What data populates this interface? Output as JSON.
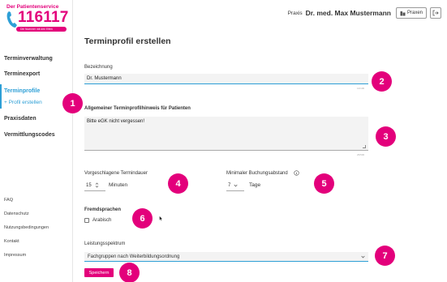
{
  "logo": {
    "top_text": "Der Patientenservice",
    "number": "116117",
    "subtitle": "Die Nummer mit den Elfen"
  },
  "sidebar": {
    "items": [
      {
        "label": "Terminverwaltung"
      },
      {
        "label": "Terminexport"
      },
      {
        "label": "Terminprofile"
      },
      {
        "label": "+ Profil erstellen"
      },
      {
        "label": "Praxisdaten"
      },
      {
        "label": "Vermittlungscodes"
      }
    ],
    "footer": [
      {
        "label": "FAQ"
      },
      {
        "label": "Datenschutz"
      },
      {
        "label": "Nutzungsbedingungen"
      },
      {
        "label": "Kontakt"
      },
      {
        "label": "Impressum"
      }
    ]
  },
  "header": {
    "praxis_label": "Praxis",
    "praxis_name": "Dr. med. Max Mustermann",
    "praxen_button": "Praxen"
  },
  "main": {
    "title": "Terminprofil erstellen",
    "bezeichnung": {
      "label": "Bezeichnung",
      "value": "Dr. Mustermann",
      "counter": "14/100"
    },
    "hinweis": {
      "label": "Allgemeiner Terminprofilhinweis für Patienten",
      "value": "Bitte eGK nicht vergessen!",
      "counter": "26/500"
    },
    "termindauer": {
      "label": "Vorgeschlagene Termindauer",
      "value": "15",
      "unit": "Minuten"
    },
    "buchungsabstand": {
      "label": "Minimaler Buchungsabstand",
      "value": "7",
      "unit": "Tage"
    },
    "fremdsprachen": {
      "label": "Fremdsprachen",
      "option": "Arabisch",
      "checked": false
    },
    "leistungsspektrum": {
      "label": "Leistungsspektrum",
      "value": "Fachgruppen nach Weiterbildungsordnung"
    },
    "save_button": "Speichern"
  },
  "badges": [
    "1",
    "2",
    "3",
    "4",
    "5",
    "6",
    "7",
    "8"
  ],
  "colors": {
    "accent_pink": "#e3007b",
    "accent_blue": "#2d9fd6"
  }
}
